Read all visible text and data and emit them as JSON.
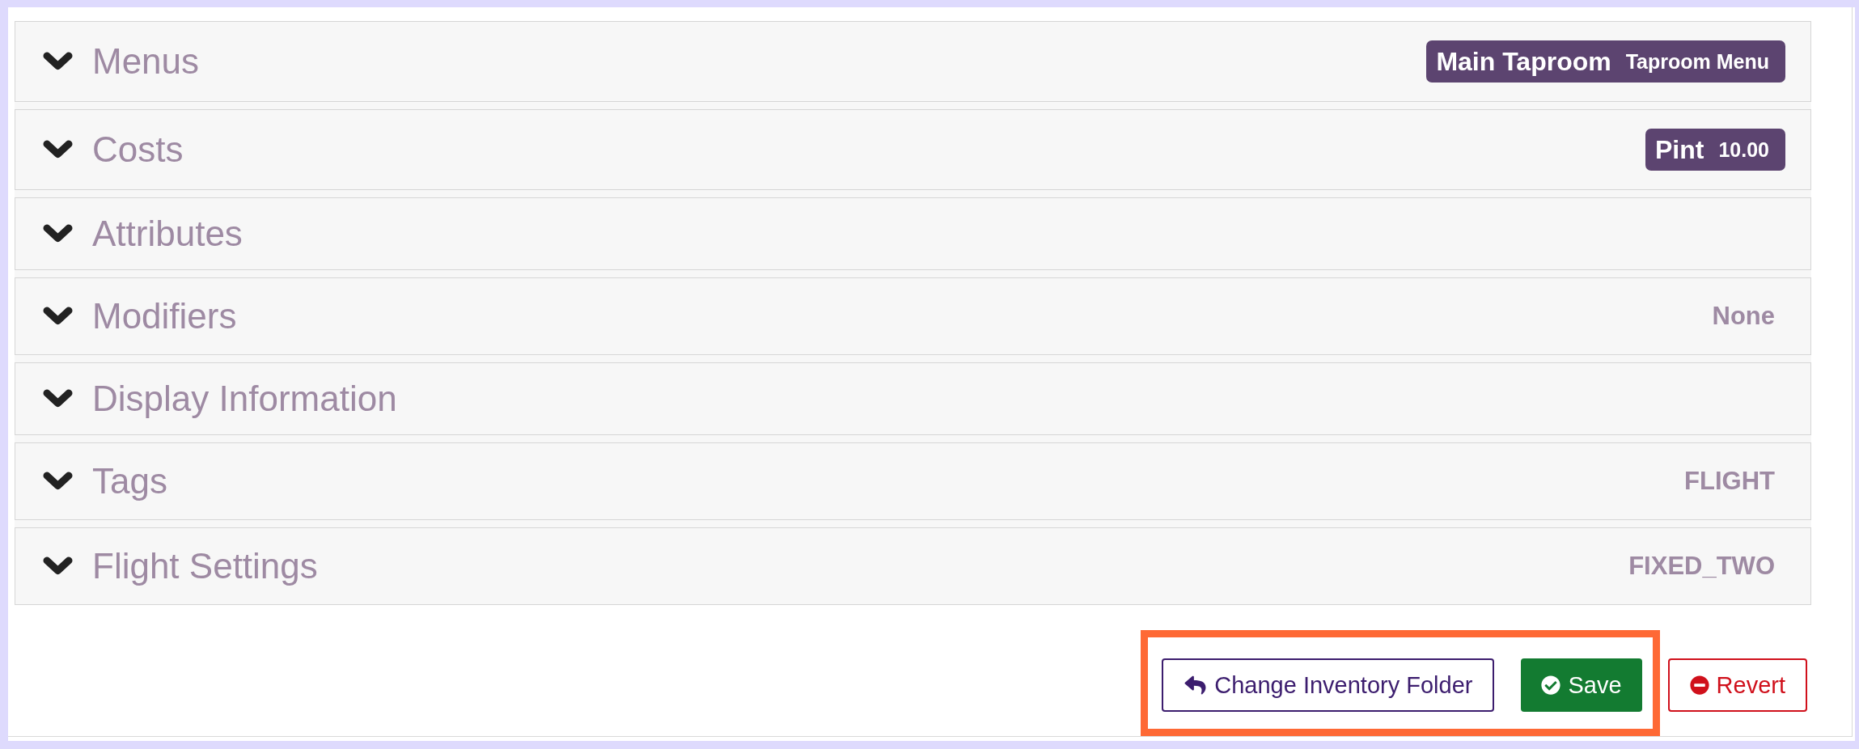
{
  "sections": [
    {
      "title": "Menus",
      "expanded": false,
      "summary": {
        "kind": "badge",
        "primary": "Main Taproom",
        "secondary": "Taproom Menu"
      }
    },
    {
      "title": "Costs",
      "expanded": false,
      "summary": {
        "kind": "badge",
        "primary": "Pint",
        "secondary": "10.00"
      }
    },
    {
      "title": "Attributes",
      "expanded": false
    },
    {
      "title": "Modifiers",
      "expanded": false,
      "summary": {
        "kind": "text",
        "text": "None"
      }
    },
    {
      "title": "Display Information",
      "expanded": false
    },
    {
      "title": "Tags",
      "expanded": false,
      "summary": {
        "kind": "text",
        "text": "FLIGHT"
      }
    },
    {
      "title": "Flight Settings",
      "expanded": false,
      "summary": {
        "kind": "text",
        "text": "FIXED_TWO"
      }
    }
  ],
  "actions": [
    {
      "label": "Change Inventory Folder",
      "kind": "back",
      "highlighted": true
    },
    {
      "label": "Save",
      "kind": "save",
      "highlighted": true
    },
    {
      "label": "Revert",
      "kind": "revert",
      "highlighted": false
    }
  ]
}
